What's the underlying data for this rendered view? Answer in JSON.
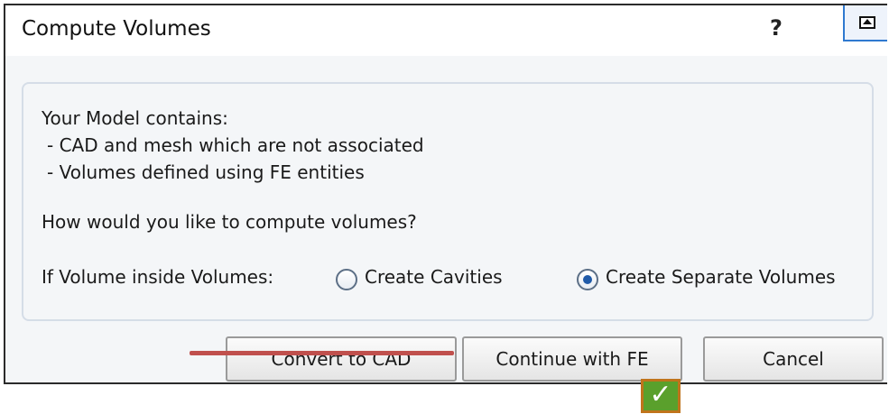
{
  "dialog": {
    "title": "Compute Volumes",
    "help_label": "?",
    "restore_icon": "restore-window-icon"
  },
  "message": {
    "intro": "Your Model contains:",
    "items": [
      "- CAD and mesh which are not associated",
      "- Volumes defined using FE entities"
    ],
    "question": "How would you like to compute volumes?"
  },
  "option": {
    "label": "If Volume inside Volumes:",
    "choices": [
      {
        "label": "Create Cavities",
        "selected": false
      },
      {
        "label": "Create Separate Volumes",
        "selected": true
      }
    ]
  },
  "buttons": {
    "convert_label": "Convert to CAD",
    "continue_label": "Continue with FE",
    "cancel_label": "Cancel"
  },
  "annotations": {
    "strike_color": "#c0504d",
    "check_glyph": "✓",
    "check_color": "#5aa02c"
  }
}
